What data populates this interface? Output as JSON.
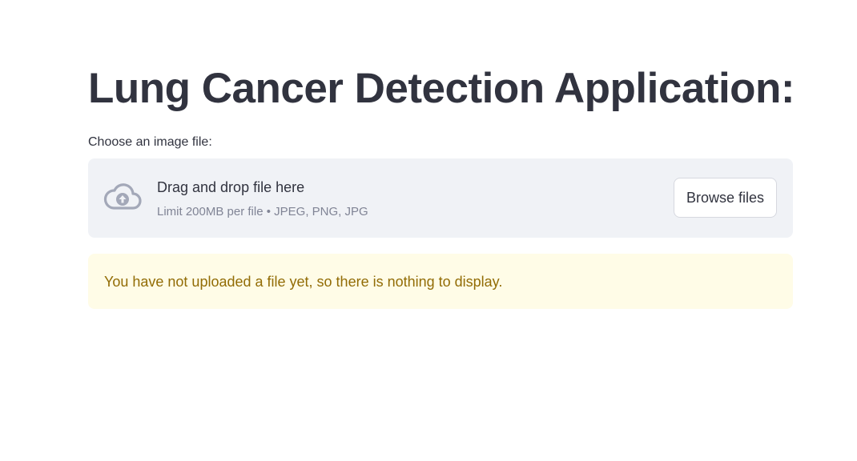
{
  "title": "Lung Cancer Detection Application:",
  "uploader": {
    "label": "Choose an image file:",
    "drop_text": "Drag and drop file here",
    "hint": "Limit 200MB per file • JPEG, PNG, JPG",
    "browse_label": "Browse files",
    "icon": "cloud-upload-icon"
  },
  "alert": {
    "message": "You have not uploaded a file yet, so there is nothing to display."
  },
  "colors": {
    "text": "#31333f",
    "dropzone_bg": "#f0f2f6",
    "hint_text": "#808495",
    "icon": "#a3a8b8",
    "alert_bg": "#fffce7",
    "alert_text": "#926c05"
  }
}
